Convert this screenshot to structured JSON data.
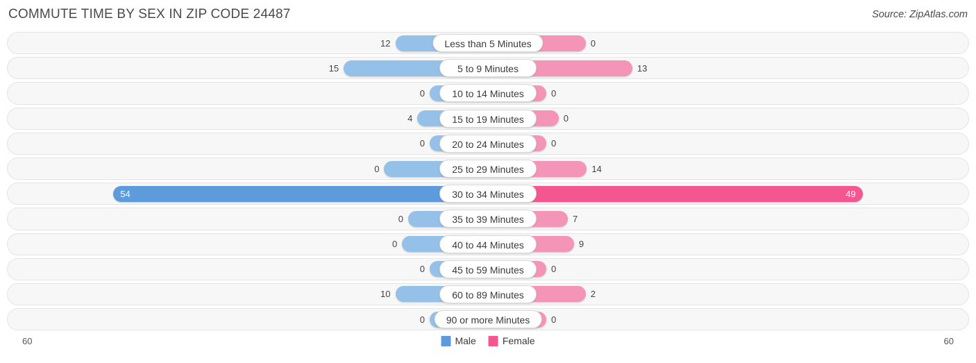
{
  "header": {
    "title": "COMMUTE TIME BY SEX IN ZIP CODE 24487",
    "source": "Source: ZipAtlas.com"
  },
  "legend": {
    "male_label": "Male",
    "female_label": "Female",
    "male_color": "#5d9bdd",
    "female_color": "#f4578f"
  },
  "axis": {
    "left_max": "60",
    "right_max": "60"
  },
  "chart_data": {
    "type": "bar",
    "title": "COMMUTE TIME BY SEX IN ZIP CODE 24487",
    "orientation": "horizontal-diverging",
    "xlabel": "",
    "ylabel": "",
    "xlim": [
      60,
      60
    ],
    "grid": false,
    "legend_position": "bottom-center",
    "categories": [
      "Less than 5 Minutes",
      "5 to 9 Minutes",
      "10 to 14 Minutes",
      "15 to 19 Minutes",
      "20 to 24 Minutes",
      "25 to 29 Minutes",
      "30 to 34 Minutes",
      "35 to 39 Minutes",
      "40 to 44 Minutes",
      "45 to 59 Minutes",
      "60 to 89 Minutes",
      "90 or more Minutes"
    ],
    "series": [
      {
        "name": "Male",
        "color": "#95c0e8",
        "highlight_color": "#5d9bdd",
        "values": [
          12,
          15,
          0,
          4,
          0,
          0,
          54,
          0,
          0,
          0,
          10,
          0
        ]
      },
      {
        "name": "Female",
        "color": "#f495b8",
        "highlight_color": "#f4578f",
        "values": [
          0,
          13,
          0,
          0,
          0,
          14,
          49,
          7,
          9,
          0,
          2,
          0
        ]
      }
    ],
    "highlight_row": "30 to 34 Minutes"
  },
  "rows": [
    {
      "label": "Less than 5 Minutes",
      "male": "12",
      "female": "0",
      "male_v": 12,
      "female_v": 0,
      "highlight": false
    },
    {
      "label": "5 to 9 Minutes",
      "male": "15",
      "female": "13",
      "male_v": 15,
      "female_v": 13,
      "highlight": false
    },
    {
      "label": "10 to 14 Minutes",
      "male": "0",
      "female": "0",
      "male_v": 0,
      "female_v": 0,
      "highlight": false
    },
    {
      "label": "15 to 19 Minutes",
      "male": "4",
      "female": "0",
      "male_v": 4,
      "female_v": 0,
      "highlight": false
    },
    {
      "label": "20 to 24 Minutes",
      "male": "0",
      "female": "0",
      "male_v": 0,
      "female_v": 0,
      "highlight": false
    },
    {
      "label": "25 to 29 Minutes",
      "male": "0",
      "female": "14",
      "male_v": 0,
      "female_v": 14,
      "highlight": false
    },
    {
      "label": "30 to 34 Minutes",
      "male": "54",
      "female": "49",
      "male_v": 54,
      "female_v": 49,
      "highlight": true
    },
    {
      "label": "35 to 39 Minutes",
      "male": "0",
      "female": "7",
      "male_v": 0,
      "female_v": 7,
      "highlight": false
    },
    {
      "label": "40 to 44 Minutes",
      "male": "0",
      "female": "9",
      "male_v": 0,
      "female_v": 9,
      "highlight": false
    },
    {
      "label": "45 to 59 Minutes",
      "male": "0",
      "female": "0",
      "male_v": 0,
      "female_v": 0,
      "highlight": false
    },
    {
      "label": "60 to 89 Minutes",
      "male": "10",
      "female": "2",
      "male_v": 10,
      "female_v": 2,
      "highlight": false
    },
    {
      "label": "90 or more Minutes",
      "male": "0",
      "female": "0",
      "male_v": 0,
      "female_v": 0,
      "highlight": false
    }
  ]
}
